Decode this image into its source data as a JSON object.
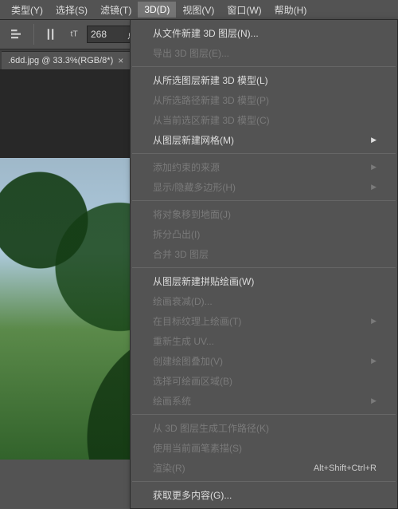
{
  "menubar": {
    "items": [
      {
        "label": "类型(Y)"
      },
      {
        "label": "选择(S)"
      },
      {
        "label": "滤镜(T)"
      },
      {
        "label": "3D(D)"
      },
      {
        "label": "视图(V)"
      },
      {
        "label": "窗口(W)"
      },
      {
        "label": "帮助(H)"
      }
    ],
    "active_index": 3
  },
  "toolbar": {
    "font_size_value": "268",
    "font_size_unit": "点"
  },
  "doc_tab": {
    "title": ".6dd.jpg @ 33.3%(RGB/8*)",
    "close": "×"
  },
  "dropdown": {
    "groups": [
      [
        {
          "label": "从文件新建 3D 图层(N)...",
          "disabled": false
        },
        {
          "label": "导出 3D 图层(E)...",
          "disabled": true
        }
      ],
      [
        {
          "label": "从所选图层新建 3D 模型(L)",
          "disabled": false
        },
        {
          "label": "从所选路径新建 3D 模型(P)",
          "disabled": true
        },
        {
          "label": "从当前选区新建 3D 模型(C)",
          "disabled": true
        },
        {
          "label": "从图层新建网格(M)",
          "disabled": false,
          "submenu": true
        }
      ],
      [
        {
          "label": "添加约束的来源",
          "disabled": true,
          "submenu": true
        },
        {
          "label": "显示/隐藏多边形(H)",
          "disabled": true,
          "submenu": true
        }
      ],
      [
        {
          "label": "将对象移到地面(J)",
          "disabled": true
        },
        {
          "label": "拆分凸出(I)",
          "disabled": true
        },
        {
          "label": "合并 3D 图层",
          "disabled": true
        }
      ],
      [
        {
          "label": "从图层新建拼贴绘画(W)",
          "disabled": false
        },
        {
          "label": "绘画衰减(D)...",
          "disabled": true
        },
        {
          "label": "在目标纹理上绘画(T)",
          "disabled": true,
          "submenu": true
        },
        {
          "label": "重新生成 UV...",
          "disabled": true
        },
        {
          "label": "创建绘图叠加(V)",
          "disabled": true,
          "submenu": true
        },
        {
          "label": "选择可绘画区域(B)",
          "disabled": true
        },
        {
          "label": "绘画系统",
          "disabled": true,
          "submenu": true
        }
      ],
      [
        {
          "label": "从 3D 图层生成工作路径(K)",
          "disabled": true
        },
        {
          "label": "使用当前画笔素描(S)",
          "disabled": true
        },
        {
          "label": "渲染(R)",
          "disabled": true,
          "shortcut": "Alt+Shift+Ctrl+R"
        }
      ],
      [
        {
          "label": "获取更多内容(G)...",
          "disabled": false
        }
      ]
    ]
  }
}
